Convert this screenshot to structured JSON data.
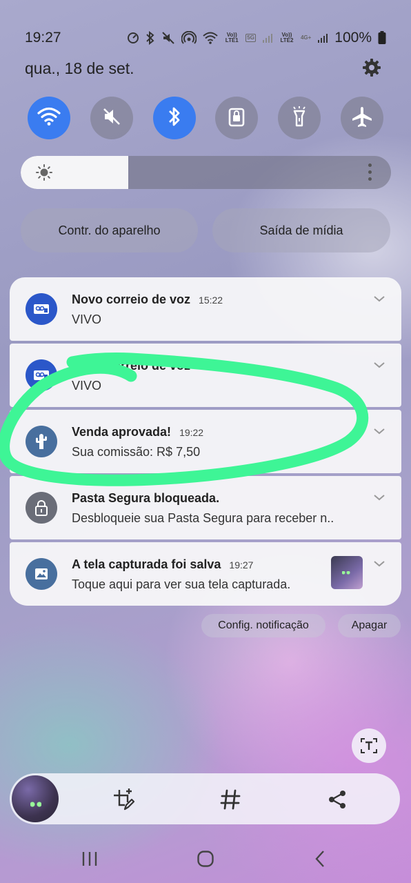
{
  "status_bar": {
    "time": "19:27",
    "sim1_label": "Vo)) LTE1",
    "sim2_label": "Vo)) LTE2",
    "net1": "5G",
    "net2": "4G+",
    "battery": "100%",
    "icons": [
      "nfc-icon",
      "bluetooth-icon",
      "mute-icon",
      "hotspot-icon",
      "wifi-icon",
      "signal-icon",
      "battery-icon"
    ]
  },
  "date": "qua., 18 de set.",
  "quick_toggles": [
    {
      "name": "wifi",
      "icon": "wifi-icon",
      "on": true
    },
    {
      "name": "sound",
      "icon": "mute-icon",
      "on": false
    },
    {
      "name": "bluetooth",
      "icon": "bluetooth-icon",
      "on": true
    },
    {
      "name": "rotation-lock",
      "icon": "lock-icon",
      "on": false
    },
    {
      "name": "flashlight",
      "icon": "flashlight-icon",
      "on": false
    },
    {
      "name": "airplane",
      "icon": "airplane-icon",
      "on": false
    }
  ],
  "brightness_level": 0.29,
  "pills": {
    "device_control": "Contr. do aparelho",
    "media_output": "Saída de mídia"
  },
  "notifications": [
    {
      "title": "Novo correio de voz",
      "time": "15:22",
      "body": "VIVO",
      "icon": "voicemail-icon"
    },
    {
      "title": "Novo correio de voz",
      "time": "",
      "body": "VIVO",
      "icon": "voicemail-icon"
    },
    {
      "title": "Venda aprovada!",
      "time": "19:22",
      "body": "Sua comissão: R$ 7,50",
      "icon": "cactus-icon"
    },
    {
      "title": "Pasta Segura bloqueada.",
      "time": "",
      "body": "Desbloqueie sua Pasta Segura para receber n..",
      "icon": "lock-icon"
    },
    {
      "title": "A tela capturada foi salva",
      "time": "19:27",
      "body": "Toque aqui para ver sua tela capturada.",
      "icon": "image-icon"
    }
  ],
  "footer_buttons": {
    "config": "Config. notificação",
    "clear": "Apagar"
  },
  "screenshot_toolbar": {
    "icons": [
      "text-extract-icon",
      "crop-edit-icon",
      "hashtag-icon",
      "share-icon"
    ]
  },
  "nav": {
    "icons": [
      "recents-icon",
      "home-icon",
      "back-icon"
    ]
  },
  "colors": {
    "accent": "#3a7cf0",
    "annotation": "#3ef596"
  }
}
